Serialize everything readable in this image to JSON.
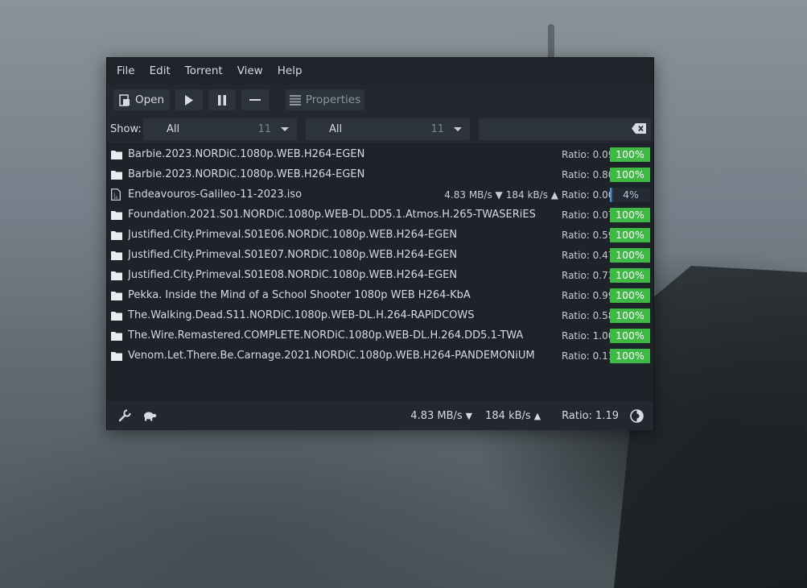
{
  "menu": [
    "File",
    "Edit",
    "Torrent",
    "View",
    "Help"
  ],
  "toolbar": {
    "open_label": "Open",
    "properties_label": "Properties"
  },
  "filter": {
    "show_label": "Show:",
    "activity": {
      "value": "All",
      "count": "11"
    },
    "tracker": {
      "value": "All",
      "count": "11"
    },
    "search_value": ""
  },
  "colors": {
    "progress_complete": "#3fb846",
    "progress_partial": "#4f8fd8"
  },
  "torrents": [
    {
      "icon": "folder-icon",
      "name": "Barbie.2023.NORDiC.1080p.WEB.H264-EGEN",
      "down": "",
      "up": "",
      "ratio": "Ratio: 0.09",
      "progress": 100,
      "progress_label": "100%"
    },
    {
      "icon": "folder-icon",
      "name": "Barbie.2023.NORDiC.1080p.WEB.H264-EGEN",
      "down": "",
      "up": "",
      "ratio": "Ratio: 0.80",
      "progress": 100,
      "progress_label": "100%"
    },
    {
      "icon": "disc-image-file-icon",
      "name": "Endeavouros-Galileo-11-2023.iso",
      "down": "4.83 MB/s ▼",
      "up": "184 kB/s ▲",
      "ratio": "Ratio: 0.00",
      "progress": 4,
      "progress_label": "4%"
    },
    {
      "icon": "folder-icon",
      "name": "Foundation.2021.S01.NORDiC.1080p.WEB-DL.DD5.1.Atmos.H.265-TWASERiES",
      "down": "",
      "up": "",
      "ratio": "Ratio: 0.07",
      "progress": 100,
      "progress_label": "100%"
    },
    {
      "icon": "folder-icon",
      "name": "Justified.City.Primeval.S01E06.NORDiC.1080p.WEB.H264-EGEN",
      "down": "",
      "up": "",
      "ratio": "Ratio: 0.59",
      "progress": 100,
      "progress_label": "100%"
    },
    {
      "icon": "folder-icon",
      "name": "Justified.City.Primeval.S01E07.NORDiC.1080p.WEB.H264-EGEN",
      "down": "",
      "up": "",
      "ratio": "Ratio: 0.47",
      "progress": 100,
      "progress_label": "100%"
    },
    {
      "icon": "folder-icon",
      "name": "Justified.City.Primeval.S01E08.NORDiC.1080p.WEB.H264-EGEN",
      "down": "",
      "up": "",
      "ratio": "Ratio: 0.73",
      "progress": 100,
      "progress_label": "100%"
    },
    {
      "icon": "folder-icon",
      "name": "Pekka. Inside the Mind of a School Shooter 1080p WEB H264-KbA",
      "down": "",
      "up": "",
      "ratio": "Ratio: 0.99",
      "progress": 100,
      "progress_label": "100%"
    },
    {
      "icon": "folder-icon",
      "name": "The.Walking.Dead.S11.NORDiC.1080p.WEB-DL.H.264-RAPiDCOWS",
      "down": "",
      "up": "",
      "ratio": "Ratio: 0.58",
      "progress": 100,
      "progress_label": "100%"
    },
    {
      "icon": "folder-icon",
      "name": "The.Wire.Remastered.COMPLETE.NORDiC.1080p.WEB-DL.H.264.DD5.1-TWA",
      "down": "",
      "up": "",
      "ratio": "Ratio: 1.00",
      "progress": 100,
      "progress_label": "100%"
    },
    {
      "icon": "folder-icon",
      "name": "Venom.Let.There.Be.Carnage.2021.NORDiC.1080p.WEB.H264-PANDEMONiUM",
      "down": "",
      "up": "",
      "ratio": "Ratio: 0.11",
      "progress": 100,
      "progress_label": "100%"
    }
  ],
  "status": {
    "down_speed": "4.83 MB/s",
    "up_speed": "184 kB/s",
    "ratio": "Ratio: 1.19"
  }
}
